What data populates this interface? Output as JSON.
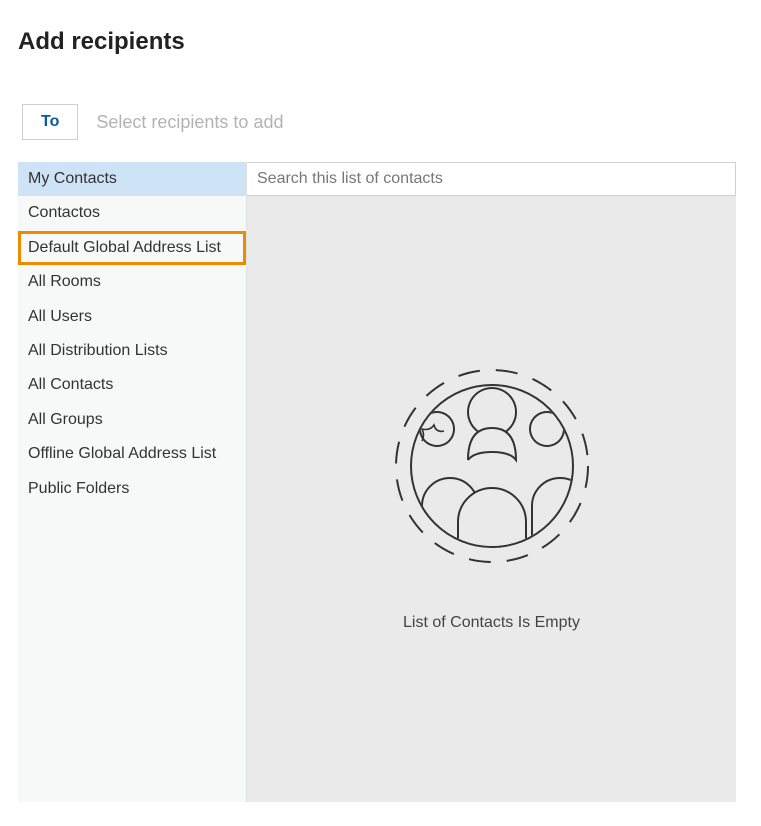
{
  "title": "Add recipients",
  "to_chip_label": "To",
  "recipient_placeholder": "Select recipients to add",
  "sidebar": {
    "items": [
      {
        "label": "My Contacts",
        "selected": true,
        "highlighted": false
      },
      {
        "label": "Contactos",
        "selected": false,
        "highlighted": false
      },
      {
        "label": "Default Global Address List",
        "selected": false,
        "highlighted": true
      },
      {
        "label": "All Rooms",
        "selected": false,
        "highlighted": false
      },
      {
        "label": "All Users",
        "selected": false,
        "highlighted": false
      },
      {
        "label": "All Distribution Lists",
        "selected": false,
        "highlighted": false
      },
      {
        "label": "All Contacts",
        "selected": false,
        "highlighted": false
      },
      {
        "label": "All Groups",
        "selected": false,
        "highlighted": false
      },
      {
        "label": "Offline Global Address List",
        "selected": false,
        "highlighted": false
      },
      {
        "label": "Public Folders",
        "selected": false,
        "highlighted": false
      }
    ]
  },
  "search": {
    "placeholder": "Search this list of contacts",
    "value": ""
  },
  "empty_message": "List of Contacts Is Empty",
  "colors": {
    "highlight_border": "#ee8a00",
    "selected_bg": "#cfe3f7",
    "sidebar_bg": "#f7f8f8",
    "content_bg": "#eaeaea",
    "to_chip_text": "#0a5a9c"
  }
}
